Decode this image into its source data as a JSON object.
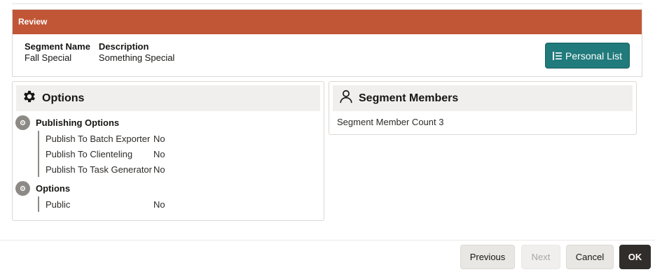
{
  "review": {
    "header": "Review",
    "segment_name_label": "Segment Name",
    "segment_name_value": "Fall Special",
    "description_label": "Description",
    "description_value": "Something Special",
    "personal_list_button": "Personal List"
  },
  "options_card": {
    "title": "Options",
    "groups": [
      {
        "title": "Publishing Options",
        "rows": [
          {
            "label": "Publish To Batch Exporter",
            "value": "No"
          },
          {
            "label": "Publish To Clienteling",
            "value": "No"
          },
          {
            "label": "Publish To Task Generator",
            "value": "No"
          }
        ]
      },
      {
        "title": "Options",
        "rows": [
          {
            "label": "Public",
            "value": "No"
          }
        ]
      }
    ]
  },
  "members_card": {
    "title": "Segment Members",
    "count_text": "Segment Member Count 3"
  },
  "footer": {
    "previous": "Previous",
    "next": "Next",
    "cancel": "Cancel",
    "ok": "OK"
  },
  "colors": {
    "header_bg": "#c05636",
    "primary_teal": "#217a7c",
    "ok_dark": "#312d2a"
  }
}
